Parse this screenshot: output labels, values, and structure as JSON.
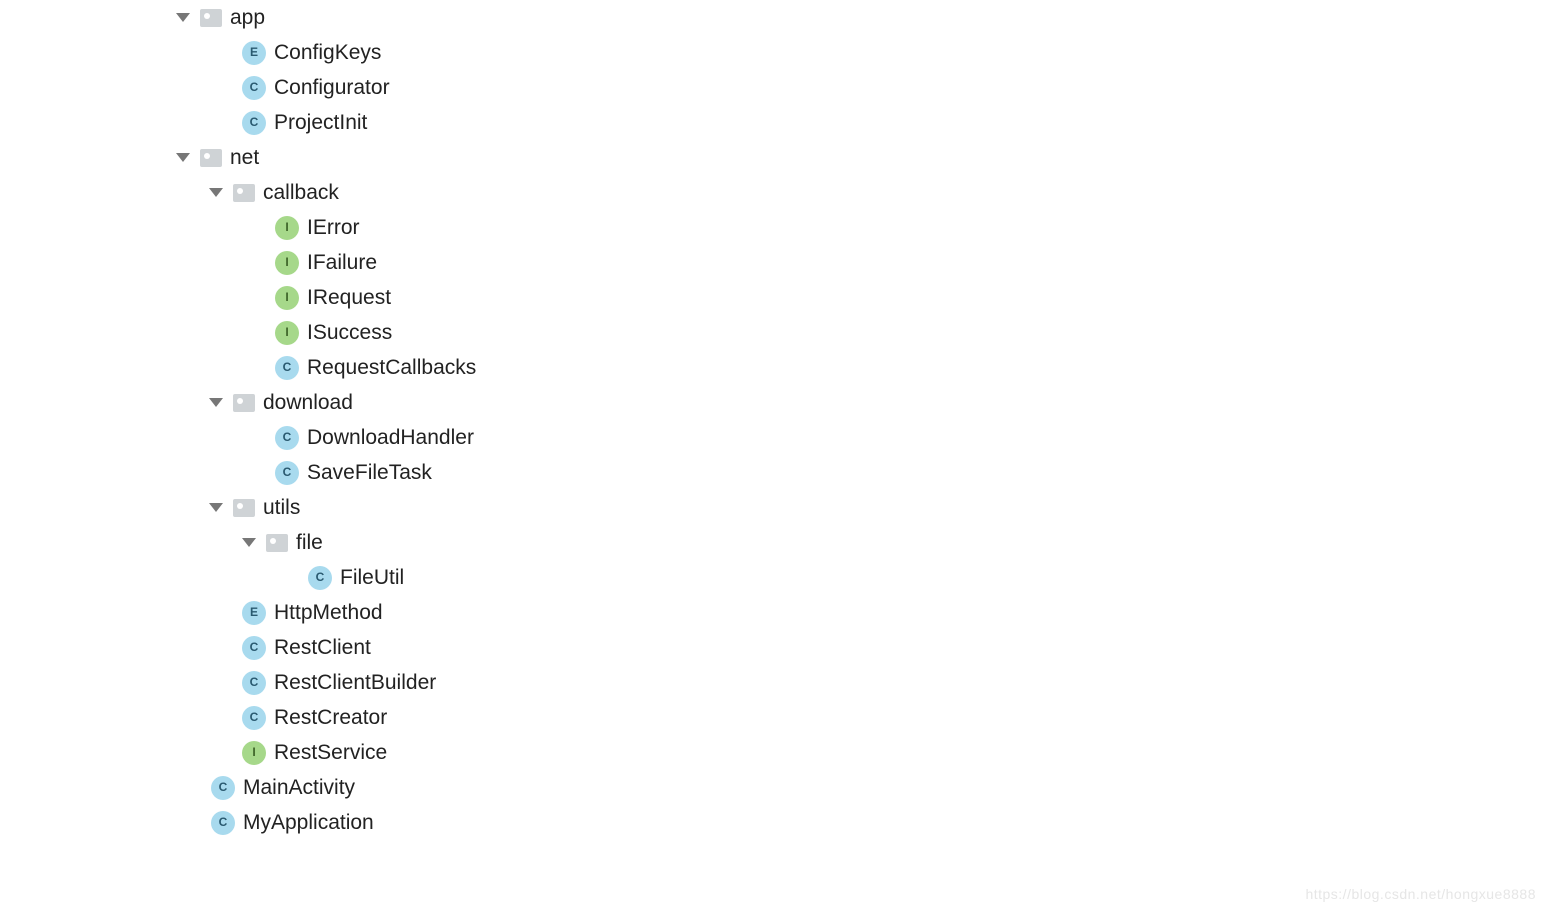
{
  "watermark": "https://blog.csdn.net/hongxue8888",
  "icon_letters": {
    "class": "C",
    "enum": "E",
    "interface": "I"
  },
  "tree": [
    {
      "depth": 0,
      "kind": "dir",
      "label": "app",
      "expanded": true
    },
    {
      "depth": 1,
      "kind": "enum",
      "label": "ConfigKeys"
    },
    {
      "depth": 1,
      "kind": "class",
      "label": "Configurator"
    },
    {
      "depth": 1,
      "kind": "class",
      "label": "ProjectInit"
    },
    {
      "depth": 0,
      "kind": "dir",
      "label": "net",
      "expanded": true
    },
    {
      "depth": 1,
      "kind": "dir",
      "label": "callback",
      "expanded": true
    },
    {
      "depth": 2,
      "kind": "interface",
      "label": "IError"
    },
    {
      "depth": 2,
      "kind": "interface",
      "label": "IFailure"
    },
    {
      "depth": 2,
      "kind": "interface",
      "label": "IRequest"
    },
    {
      "depth": 2,
      "kind": "interface",
      "label": "ISuccess"
    },
    {
      "depth": 2,
      "kind": "class",
      "label": "RequestCallbacks"
    },
    {
      "depth": 1,
      "kind": "dir",
      "label": "download",
      "expanded": true
    },
    {
      "depth": 2,
      "kind": "class",
      "label": "DownloadHandler"
    },
    {
      "depth": 2,
      "kind": "class",
      "label": "SaveFileTask"
    },
    {
      "depth": 1,
      "kind": "dir",
      "label": "utils",
      "expanded": true
    },
    {
      "depth": 2,
      "kind": "dir",
      "label": "file",
      "expanded": true
    },
    {
      "depth": 3,
      "kind": "class",
      "label": "FileUtil"
    },
    {
      "depth": 1,
      "kind": "enum",
      "label": "HttpMethod"
    },
    {
      "depth": 1,
      "kind": "class",
      "label": "RestClient"
    },
    {
      "depth": 1,
      "kind": "class",
      "label": "RestClientBuilder"
    },
    {
      "depth": 1,
      "kind": "class",
      "label": "RestCreator"
    },
    {
      "depth": 1,
      "kind": "interface",
      "label": "RestService"
    },
    {
      "depth": 0,
      "kind": "class",
      "label": "MainActivity"
    },
    {
      "depth": 0,
      "kind": "class",
      "label": "MyApplication"
    }
  ]
}
